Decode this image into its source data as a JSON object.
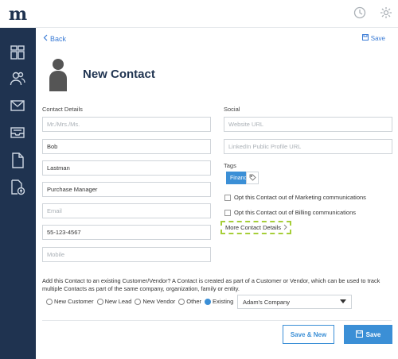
{
  "brand": {
    "logo": "m"
  },
  "topbar": {
    "icons": [
      "clock-icon",
      "gear-icon"
    ]
  },
  "sidebar": {
    "items": [
      "dashboard-icon",
      "contacts-icon",
      "mail-icon",
      "inbox-icon",
      "document-icon",
      "billing-icon"
    ]
  },
  "nav": {
    "back_label": "Back",
    "save_label": "Save"
  },
  "page": {
    "title": "New Contact"
  },
  "contact_details": {
    "label": "Contact Details",
    "salutation_placeholder": "Mr./Mrs./Ms.",
    "first_name": "Bob",
    "last_name": "Lastman",
    "job_title": "Purchase Manager",
    "email_placeholder": "Email",
    "phone": "55-123-4567",
    "mobile_placeholder": "Mobile"
  },
  "social": {
    "label": "Social",
    "website_placeholder": "Website URL",
    "linkedin_placeholder": "LinkedIn Public Profile URL",
    "tags_label": "Tags",
    "tags": [
      "Finance"
    ],
    "opt_marketing": "Opt this Contact out of Marketing communications",
    "opt_billing": "Opt this Contact out of Billing communications",
    "more_details": "More Contact Details"
  },
  "association": {
    "text": "Add this Contact to an existing Customer/Vendor? A Contact is created as part of a Customer or Vendor, which can be used to track multiple Contacts as part of the same company, organization, family or entity.",
    "options": [
      "New Customer",
      "New Lead",
      "New Vendor",
      "Other",
      "Existing"
    ],
    "selected": "Existing",
    "existing_value": "Adam's Company"
  },
  "actions": {
    "save_new": "Save & New",
    "save": "Save"
  },
  "colors": {
    "sidebar": "#1f3350",
    "accent": "#3b8fd6",
    "highlight": "#a6ce39"
  }
}
